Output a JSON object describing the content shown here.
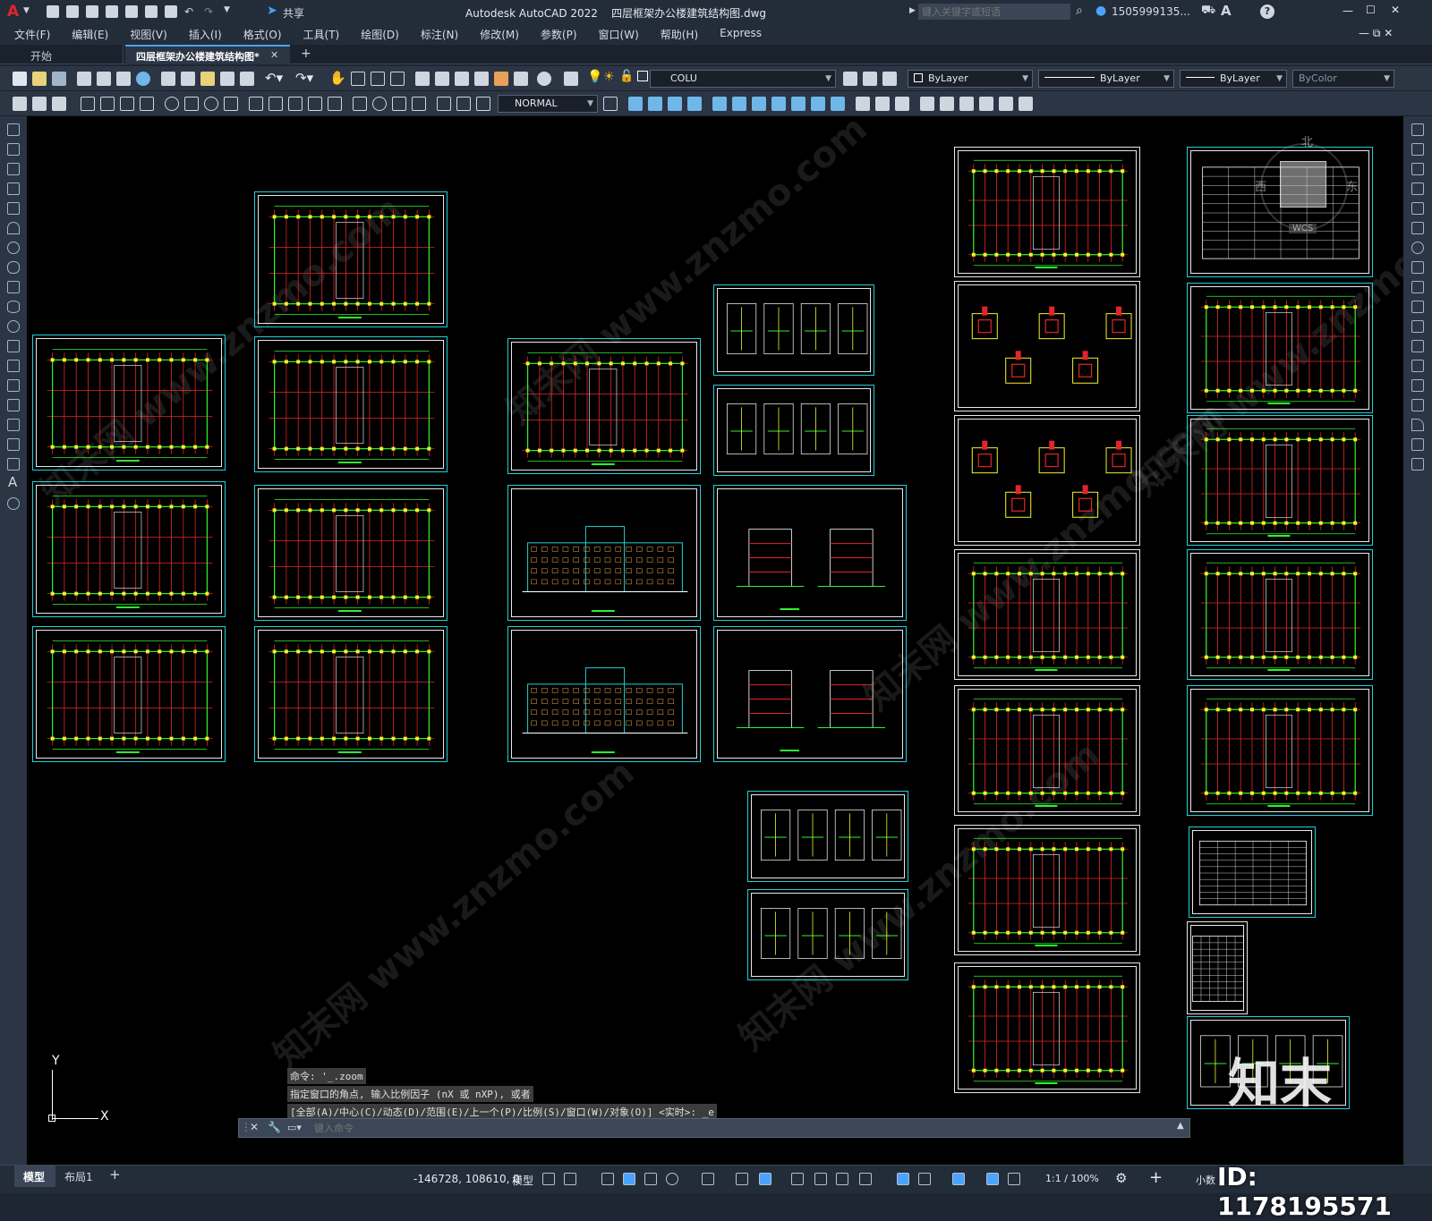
{
  "titlebar": {
    "app_menu_label": "A",
    "share_label": "共享",
    "window_title": "Autodesk AutoCAD 2022    四层框架办公楼建筑结构图.dwg",
    "search_placeholder": "键入关键字或短语",
    "user_label": "1505999135...",
    "minimize": "—",
    "maximize": "☐",
    "close": "✕",
    "help": "?"
  },
  "menubar": {
    "items": [
      "文件(F)",
      "编辑(E)",
      "视图(V)",
      "插入(I)",
      "格式(O)",
      "工具(T)",
      "绘图(D)",
      "标注(N)",
      "修改(M)",
      "参数(P)",
      "窗口(W)",
      "帮助(H)",
      "Express"
    ],
    "doc_controls": "— ⧉ ✕"
  },
  "tabs": {
    "start": "开始",
    "active": "四层框架办公楼建筑结构图*",
    "close": "✕",
    "new": "+"
  },
  "toolbar1": {
    "layer_value": "COLU",
    "color_value": "ByLayer",
    "linetype_value": "ByLayer",
    "lineweight_value": "ByLayer",
    "plotstyle_value": "ByColor"
  },
  "toolbar2": {
    "textstyle_value": "NORMAL"
  },
  "viewcube": {
    "north": "北",
    "west": "西",
    "east": "东",
    "wcs": "WCS"
  },
  "ucs": {
    "y_label": "Y",
    "x_label": "X"
  },
  "command": {
    "history": [
      "命令: '_.zoom",
      "指定窗口的角点, 输入比例因子 (nX 或 nXP), 或者",
      "[全部(A)/中心(C)/动态(D)/范围(E)/上一个(P)/比例(S)/窗口(W)/对象(O)] <实时>: _e"
    ],
    "input_placeholder": "键入命令"
  },
  "statusbar": {
    "model_tab": "模型",
    "layout_tab": "布局1",
    "add_tab": "+",
    "coordinates": "-146728, 108610, 0",
    "space": "模型",
    "scale": "1:1 / 100%",
    "units": "小数"
  },
  "overlay": {
    "id_label": "ID: 1178195571",
    "logo": "知末"
  },
  "watermarks": [
    "知末网 www.znzmo.com"
  ],
  "colors": {
    "sheet_frame": "#1fd1d8",
    "drawing_green": "#2ef22e",
    "drawing_red": "#e3242b",
    "drawing_yellow": "#f2f22e",
    "background": "#000000"
  }
}
